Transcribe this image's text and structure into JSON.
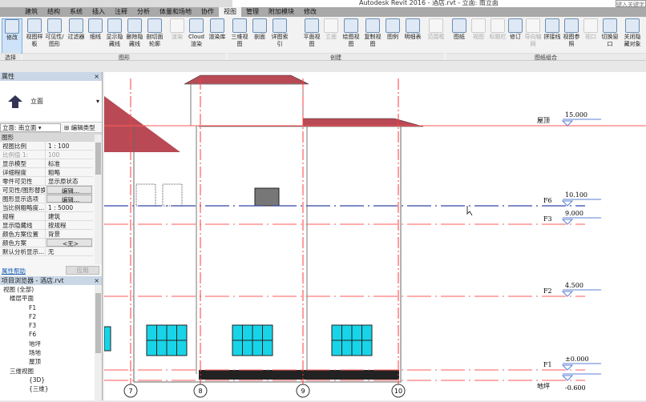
{
  "window": {
    "title": "Autodesk Revit 2016 -   酒店.rvt - 立面: 南立面",
    "search_placeholder": "键入关键字"
  },
  "tabs": [
    "建筑",
    "结构",
    "系统",
    "插入",
    "注释",
    "分析",
    "体量和场地",
    "协作",
    "视图",
    "管理",
    "附加模块",
    "修改"
  ],
  "active_tab": "视图",
  "ribbon": {
    "buttons": [
      {
        "label": "修改",
        "state": "selected"
      },
      {
        "label": "视图样板"
      },
      {
        "label": "可见性/图形"
      },
      {
        "label": "过滤器"
      },
      {
        "label": "细线"
      },
      {
        "label": "显示隐藏线"
      },
      {
        "label": "删除隐藏线"
      },
      {
        "label": "剖切面轮廓"
      },
      {
        "label": "渲染",
        "state": "disabled"
      },
      {
        "label": "Cloud渲染"
      },
      {
        "label": "渲染库"
      },
      {
        "label": "三维视图"
      },
      {
        "label": "剖面"
      },
      {
        "label": "详图索引"
      },
      {
        "label": "平面视图"
      },
      {
        "label": "立面",
        "state": "disabled"
      },
      {
        "label": "绘图视图"
      },
      {
        "label": "复制视图"
      },
      {
        "label": "图例"
      },
      {
        "label": "明细表"
      },
      {
        "label": "范围框",
        "state": "disabled"
      },
      {
        "label": "图纸"
      },
      {
        "label": "视图",
        "state": "disabled"
      },
      {
        "label": "标题栏",
        "state": "disabled"
      },
      {
        "label": "修订"
      },
      {
        "label": "导向轴网",
        "state": "disabled"
      },
      {
        "label": "拼接线"
      },
      {
        "label": "视图参照"
      },
      {
        "label": "视口",
        "state": "disabled"
      },
      {
        "label": "切换窗口"
      },
      {
        "label": "关闭隐藏对象"
      }
    ],
    "panels": [
      "选择",
      "图形",
      "创建",
      "图纸组合"
    ]
  },
  "properties": {
    "title": "属性",
    "type_name": "立面",
    "view_selector": "立面: 南立面",
    "edit_type": "编辑类型",
    "group": "图形",
    "rows": [
      {
        "k": "视图比例",
        "v": "1 : 100"
      },
      {
        "k": "比例值 1:",
        "v": "100"
      },
      {
        "k": "显示模型",
        "v": "标准"
      },
      {
        "k": "详细程度",
        "v": "粗略"
      },
      {
        "k": "零件可见性",
        "v": "显示原状态"
      },
      {
        "k": "可见性/图形替换",
        "v": "编辑..."
      },
      {
        "k": "图形显示选项",
        "v": "编辑..."
      },
      {
        "k": "当比例粗略度...",
        "v": "1 : 5000"
      },
      {
        "k": "规程",
        "v": "建筑"
      },
      {
        "k": "显示隐藏线",
        "v": "按规程"
      },
      {
        "k": "颜色方案位置",
        "v": "背景"
      },
      {
        "k": "颜色方案",
        "v": "<无>"
      },
      {
        "k": "默认分析显示...",
        "v": "无"
      }
    ],
    "help": "属性帮助",
    "apply": "应用"
  },
  "browser": {
    "title": "项目浏览器 - 酒店.rvt",
    "root": "视图 (全部)",
    "groups": [
      {
        "name": "楼层平面",
        "items": [
          "F1",
          "F2",
          "F3",
          "F6",
          "地坪",
          "场地",
          "屋顶"
        ]
      },
      {
        "name": "三维视图",
        "items": [
          "{3D}",
          "{三维}"
        ]
      }
    ]
  },
  "drawing": {
    "levels": [
      {
        "name": "屋顶",
        "elev": "15.000"
      },
      {
        "name": "F6",
        "elev": "10.100"
      },
      {
        "name": "F3",
        "elev": "9.000"
      },
      {
        "name": "F2",
        "elev": "4.500"
      },
      {
        "name": "F1",
        "elev": "±0.000"
      },
      {
        "name": "地坪",
        "elev": "-0.600"
      }
    ],
    "grids": [
      "7",
      "8",
      "9",
      "10"
    ],
    "colors": {
      "level_line": "#ff5a5a",
      "selected_level": "#3344aa",
      "roof": "#b94a55",
      "window": "#18d4e8",
      "grid": "#ff3b3b"
    }
  }
}
